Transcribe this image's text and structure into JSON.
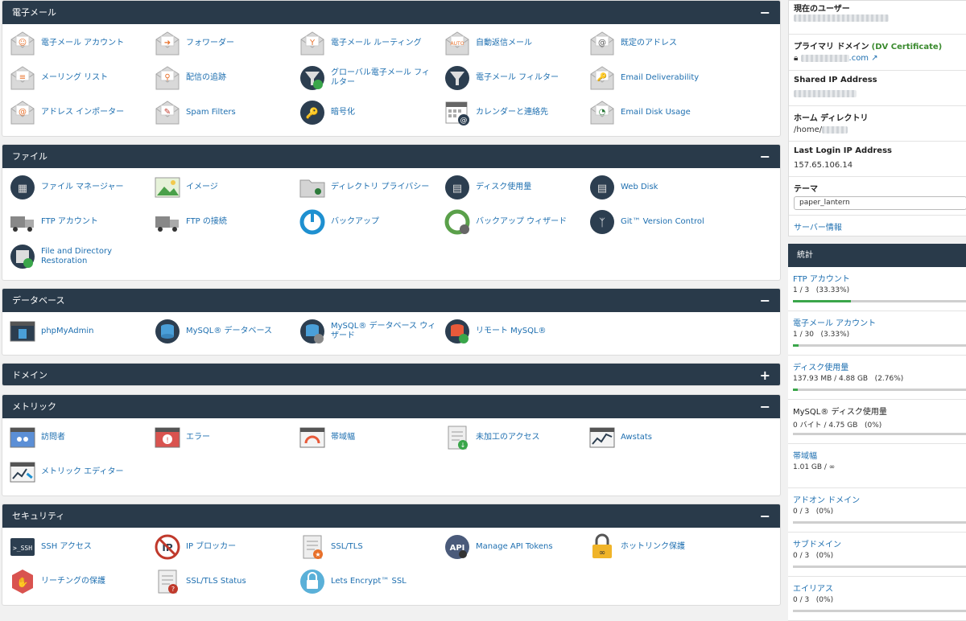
{
  "sections": [
    {
      "title": "電子メール",
      "toggle": "−",
      "items": [
        {
          "label": "電子メール アカウント",
          "icon": "email-accounts-icon"
        },
        {
          "label": "フォワーダー",
          "icon": "forwarders-icon"
        },
        {
          "label": "電子メール ルーティング",
          "icon": "email-routing-icon"
        },
        {
          "label": "自動返信メール",
          "icon": "autoresponders-icon"
        },
        {
          "label": "既定のアドレス",
          "icon": "default-address-icon"
        },
        {
          "label": "メーリング リスト",
          "icon": "mailing-lists-icon"
        },
        {
          "label": "配信の追跡",
          "icon": "track-delivery-icon"
        },
        {
          "label": "グローバル電子メール フィルター",
          "icon": "global-filters-icon"
        },
        {
          "label": "電子メール フィルター",
          "icon": "email-filters-icon"
        },
        {
          "label": "Email Deliverability",
          "icon": "email-deliverability-icon"
        },
        {
          "label": "アドレス インポーター",
          "icon": "address-importer-icon"
        },
        {
          "label": "Spam Filters",
          "icon": "spam-filters-icon"
        },
        {
          "label": "暗号化",
          "icon": "encryption-icon"
        },
        {
          "label": "カレンダーと連絡先",
          "icon": "calendars-contacts-icon"
        },
        {
          "label": "Email Disk Usage",
          "icon": "email-disk-usage-icon"
        }
      ]
    },
    {
      "title": "ファイル",
      "toggle": "−",
      "items": [
        {
          "label": "ファイル マネージャー",
          "icon": "file-manager-icon"
        },
        {
          "label": "イメージ",
          "icon": "images-icon"
        },
        {
          "label": "ディレクトリ プライバシー",
          "icon": "directory-privacy-icon"
        },
        {
          "label": "ディスク使用量",
          "icon": "disk-usage-icon"
        },
        {
          "label": "Web Disk",
          "icon": "web-disk-icon"
        },
        {
          "label": "FTP アカウント",
          "icon": "ftp-accounts-icon"
        },
        {
          "label": "FTP の接続",
          "icon": "ftp-connections-icon"
        },
        {
          "label": "バックアップ",
          "icon": "backup-icon"
        },
        {
          "label": "バックアップ ウィザード",
          "icon": "backup-wizard-icon"
        },
        {
          "label": "Git™ Version Control",
          "icon": "git-icon"
        },
        {
          "label": "File and Directory Restoration",
          "icon": "file-restoration-icon"
        }
      ]
    },
    {
      "title": "データベース",
      "toggle": "−",
      "items": [
        {
          "label": "phpMyAdmin",
          "icon": "phpmyadmin-icon"
        },
        {
          "label": "MySQL® データベース",
          "icon": "mysql-databases-icon"
        },
        {
          "label": "MySQL® データベース ウィザード",
          "icon": "mysql-wizard-icon"
        },
        {
          "label": "リモート MySQL®",
          "icon": "remote-mysql-icon"
        }
      ]
    },
    {
      "title": "ドメイン",
      "toggle": "+",
      "items": []
    },
    {
      "title": "メトリック",
      "toggle": "−",
      "items": [
        {
          "label": "訪問者",
          "icon": "visitors-icon"
        },
        {
          "label": "エラー",
          "icon": "errors-icon"
        },
        {
          "label": "帯域幅",
          "icon": "bandwidth-icon"
        },
        {
          "label": "未加工のアクセス",
          "icon": "raw-access-icon"
        },
        {
          "label": "Awstats",
          "icon": "awstats-icon"
        },
        {
          "label": "メトリック エディター",
          "icon": "metrics-editor-icon"
        }
      ]
    },
    {
      "title": "セキュリティ",
      "toggle": "−",
      "items": [
        {
          "label": "SSH アクセス",
          "icon": "ssh-access-icon"
        },
        {
          "label": "IP ブロッカー",
          "icon": "ip-blocker-icon"
        },
        {
          "label": "SSL/TLS",
          "icon": "ssl-tls-icon"
        },
        {
          "label": "Manage API Tokens",
          "icon": "api-tokens-icon"
        },
        {
          "label": "ホットリンク保護",
          "icon": "hotlink-protection-icon"
        },
        {
          "label": "リーチングの保護",
          "icon": "leech-protection-icon"
        },
        {
          "label": "SSL/TLS Status",
          "icon": "ssl-tls-status-icon"
        },
        {
          "label": "Lets Encrypt™ SSL",
          "icon": "lets-encrypt-icon"
        }
      ]
    }
  ],
  "sidebar": {
    "current_user_label": "現在のユーザー",
    "primary_domain_label": "プライマリ ドメイン",
    "primary_domain_cert": "(DV Certificate)",
    "primary_domain_suffix": ".com",
    "shared_ip_label": "Shared IP Address",
    "home_dir_label": "ホーム ディレクトリ",
    "home_dir_value": "/home/",
    "last_login_label": "Last Login IP Address",
    "last_login_value": "157.65.106.14",
    "theme_label": "テーマ",
    "theme_value": "paper_lantern",
    "server_info_link": "サーバー情報"
  },
  "stats": {
    "title": "統計",
    "items": [
      {
        "label": "FTP アカウント",
        "value": "1 / 3   (33.33%)",
        "fraction": 0.3333,
        "link": true
      },
      {
        "label": "電子メール アカウント",
        "value": "1 / 30   (3.33%)",
        "fraction": 0.0333,
        "link": true
      },
      {
        "label": "ディスク使用量",
        "value": "137.93 MB / 4.88 GB   (2.76%)",
        "fraction": 0.0276,
        "link": true
      },
      {
        "label": "MySQL® ディスク使用量",
        "value": "0 バイト / 4.75 GB   (0%)",
        "fraction": 0,
        "link": false
      },
      {
        "label": "帯域幅",
        "value": "1.01 GB / ∞",
        "fraction": null,
        "link": true
      },
      {
        "label": "アドオン ドメイン",
        "value": "0 / 3   (0%)",
        "fraction": 0,
        "link": true
      },
      {
        "label": "サブドメイン",
        "value": "0 / 3   (0%)",
        "fraction": 0,
        "link": true
      },
      {
        "label": "エイリアス",
        "value": "0 / 3   (0%)",
        "fraction": 0,
        "link": true
      }
    ]
  },
  "colors": {
    "header_bg": "#293a4a",
    "link": "#1e6fb0",
    "bar_fill": "#3aa64a"
  }
}
